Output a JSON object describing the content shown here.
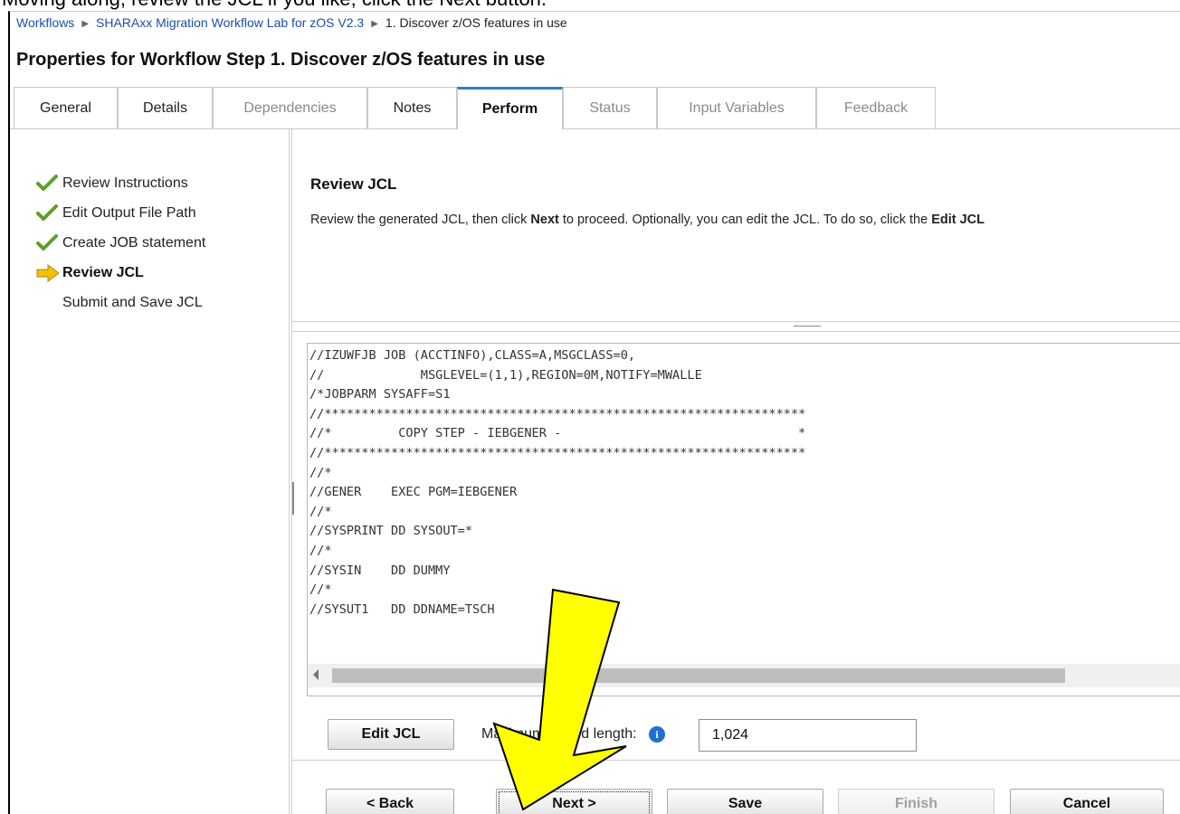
{
  "caption": "Moving along, review the JCL if you like, click the Next button.",
  "breadcrumb": {
    "items": [
      "Workflows",
      "SHARAxx Migration Workflow Lab for zOS V2.3"
    ],
    "current": "1. Discover z/OS features in use"
  },
  "page_title": "Properties for Workflow Step 1. Discover z/OS features in use",
  "tabs": [
    {
      "label": "General",
      "state": "normal"
    },
    {
      "label": "Details",
      "state": "normal"
    },
    {
      "label": "Dependencies",
      "state": "disabled"
    },
    {
      "label": "Notes",
      "state": "normal"
    },
    {
      "label": "Perform",
      "state": "active"
    },
    {
      "label": "Status",
      "state": "disabled"
    },
    {
      "label": "Input Variables",
      "state": "disabled"
    },
    {
      "label": "Feedback",
      "state": "disabled"
    }
  ],
  "steps": [
    {
      "label": "Review Instructions",
      "icon": "checkmark-icon",
      "state": "done"
    },
    {
      "label": "Edit Output File Path",
      "icon": "checkmark-icon",
      "state": "done"
    },
    {
      "label": "Create JOB statement",
      "icon": "checkmark-icon",
      "state": "done"
    },
    {
      "label": "Review JCL",
      "icon": "current-step-arrow-icon",
      "state": "current"
    },
    {
      "label": "Submit and Save JCL",
      "icon": "",
      "state": "pending"
    }
  ],
  "section": {
    "title": "Review JCL",
    "desc_prefix": "Review the generated JCL, then click ",
    "desc_bold1": "Next",
    "desc_mid": " to proceed. Optionally, you can edit the JCL. To do so, click the ",
    "desc_bold2": "Edit JCL"
  },
  "jcl_lines": [
    "//IZUWFJB JOB (ACCTINFO),CLASS=A,MSGCLASS=0,",
    "//             MSGLEVEL=(1,1),REGION=0M,NOTIFY=MWALLE",
    "/*JOBPARM SYSAFF=S1",
    "//*****************************************************************",
    "//*         COPY STEP - IEBGENER -                                *",
    "//*****************************************************************",
    "//*",
    "//GENER    EXEC PGM=IEBGENER",
    "//*",
    "//SYSPRINT DD SYSOUT=*",
    "//*",
    "//SYSIN    DD DUMMY",
    "//*",
    "//SYSUT1   DD DDNAME=TSCH"
  ],
  "edit_jcl_label": "Edit JCL",
  "max_record_label": "Maximum record length:",
  "max_record_value": "1,024",
  "footer_buttons": {
    "back": "< Back",
    "next": "Next >",
    "save": "Save",
    "finish": "Finish",
    "cancel": "Cancel"
  },
  "colors": {
    "link": "#1a4fa8",
    "active_tab_accent": "#2e7fc1",
    "check_green": "#5aa02c",
    "current_arrow": "#f2c200",
    "info_icon": "#1f6fd1",
    "callout_arrow_fill": "#ffff00"
  }
}
